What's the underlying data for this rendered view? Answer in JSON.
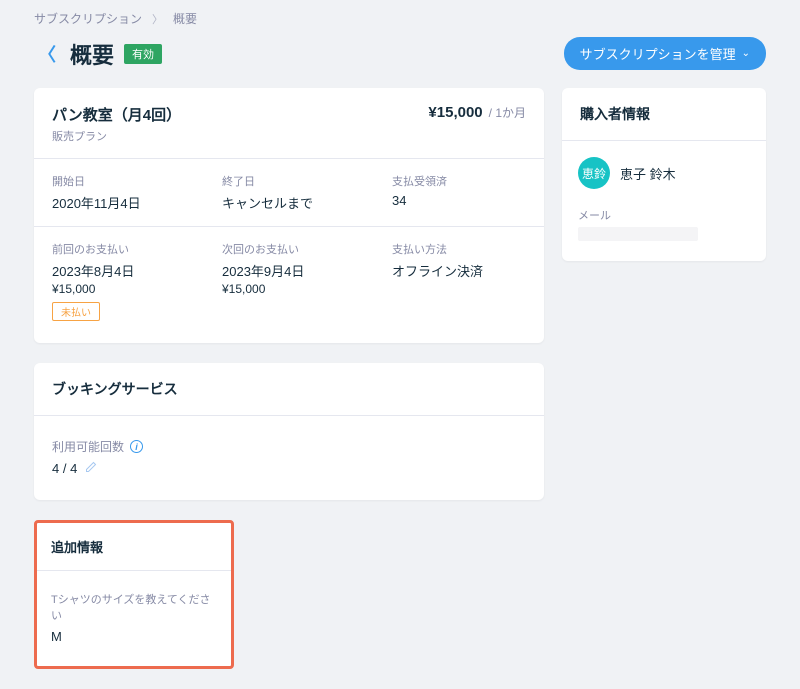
{
  "breadcrumb": {
    "root": "サブスクリプション",
    "current": "概要"
  },
  "header": {
    "title": "概要",
    "status": "有効",
    "manage_button": "サブスクリプションを管理"
  },
  "plan": {
    "name": "パン教室（月4回）",
    "subtitle": "販売プラン",
    "price": "¥15,000",
    "period": "/ 1か月",
    "fields": {
      "start_label": "開始日",
      "start_value": "2020年11月4日",
      "end_label": "終了日",
      "end_value": "キャンセルまで",
      "paid_label": "支払受領済",
      "paid_value": "34",
      "last_pay_label": "前回のお支払い",
      "last_pay_date": "2023年8月4日",
      "last_pay_amount": "¥15,000",
      "last_pay_status": "未払い",
      "next_pay_label": "次回のお支払い",
      "next_pay_date": "2023年9月4日",
      "next_pay_amount": "¥15,000",
      "method_label": "支払い方法",
      "method_value": "オフライン決済"
    }
  },
  "booking": {
    "title": "ブッキングサービス",
    "avail_label": "利用可能回数",
    "avail_value": "4 / 4"
  },
  "additional": {
    "title": "追加情報",
    "question": "Tシャツのサイズを教えてください",
    "answer": "M"
  },
  "buyer": {
    "title": "購入者情報",
    "avatar_text": "恵鈴",
    "name": "恵子 鈴木",
    "email_label": "メール"
  }
}
